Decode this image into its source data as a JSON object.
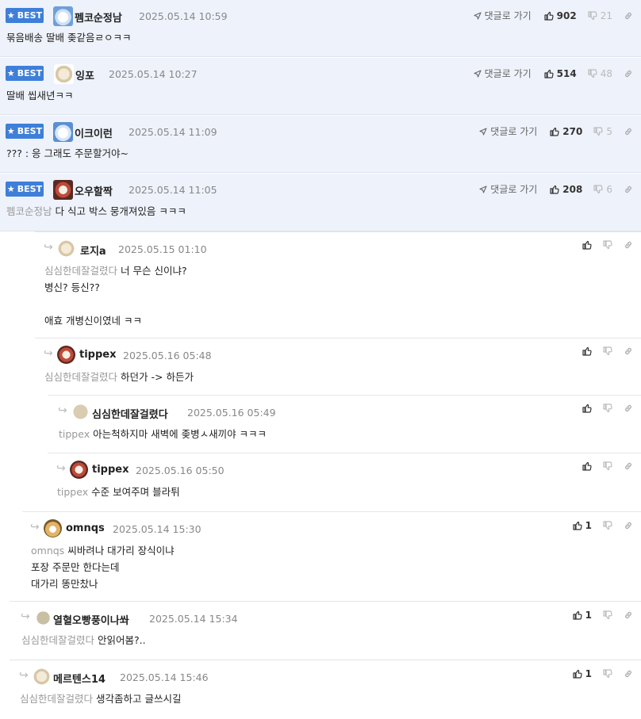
{
  "best_label": "BEST",
  "goto_label": "댓글로 가기",
  "best_comments": [
    {
      "author": "펨코순정남",
      "date": "2025.05.14 10:59",
      "body": "묶음배송 딸배 좆같음ㄹㅇㅋㅋ",
      "likes": "902",
      "dislikes": "21",
      "mention": ""
    },
    {
      "author": "잉포",
      "date": "2025.05.14 10:27",
      "body": "딸배 씹새년ㅋㅋ",
      "likes": "514",
      "dislikes": "48",
      "mention": ""
    },
    {
      "author": "이크이런",
      "date": "2025.05.14 11:09",
      "body": "??? : 응 그래도 주문할거야~",
      "likes": "270",
      "dislikes": "5",
      "mention": ""
    },
    {
      "author": "오우할짝",
      "date": "2025.05.14 11:05",
      "body": "다 식고 박스 뭉개져있음 ㅋㅋㅋ",
      "likes": "208",
      "dislikes": "6",
      "mention": "펨코순정남"
    }
  ],
  "replies": [
    {
      "author": "로지a",
      "date": "2025.05.15 01:10",
      "mention": "심심한데잘걸렸다",
      "lines": [
        "너 무슨 신이냐?",
        "병신? 등신??",
        "",
        "애효 개병신이였네 ㅋㅋ"
      ],
      "likes": "",
      "dislikes": ""
    },
    {
      "author": "tippex",
      "date": "2025.05.16 05:48",
      "mention": "심심한데잘걸렸다",
      "lines": [
        "하던가 -> 하든가"
      ],
      "likes": "",
      "dislikes": ""
    },
    {
      "author": "심심한데잘걸렸다",
      "date": "2025.05.16 05:49",
      "mention": "tippex",
      "lines": [
        "아는척하지마 새벽에 좆병ㅅ새끼야 ㅋㅋㅋ"
      ],
      "likes": "",
      "dislikes": ""
    },
    {
      "author": "tippex",
      "date": "2025.05.16 05:50",
      "mention": "tippex",
      "lines": [
        "수준 보여주며 블라튀"
      ],
      "likes": "",
      "dislikes": ""
    },
    {
      "author": "omnqs",
      "date": "2025.05.14 15:30",
      "mention": "omnqs",
      "lines": [
        "씨바려나 대가리 장식이냐",
        "포장 주문만 한다는데",
        "대가리 똥만찼나"
      ],
      "likes": "1",
      "dislikes": ""
    },
    {
      "author": "열혈오빵풍이나쏴",
      "date": "2025.05.14 15:34",
      "mention": "심심한데잘걸렸다",
      "lines": [
        "안읽어봄?.."
      ],
      "likes": "1",
      "dislikes": ""
    },
    {
      "author": "메르텐스14",
      "date": "2025.05.14 15:46",
      "mention": "심심한데잘걸렸다",
      "lines": [
        "생각좀하고 글쓰시길"
      ],
      "likes": "1",
      "dislikes": ""
    }
  ],
  "colors": {
    "best_badge": "#3e7fd9",
    "best_bg": "#eef2fb",
    "mention": "#999999"
  },
  "icons": [
    "star-icon",
    "thumbs-up-icon",
    "thumbs-down-icon",
    "link-icon",
    "send-arrow-icon",
    "reply-arrow-icon"
  ]
}
